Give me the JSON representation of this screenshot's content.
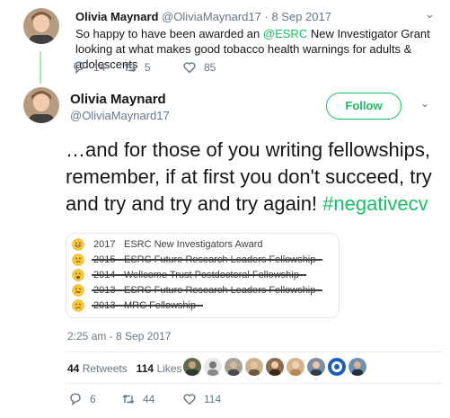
{
  "parent": {
    "name": "Olivia Maynard",
    "handle": "@OliviaMaynard17",
    "separator": "·",
    "date": "8 Sep 2017",
    "text_before": "So happy to have been awarded an ",
    "mention": "@ESRC",
    "text_after": " New Investigator Grant looking at what makes good tobacco health warnings for adults & adolescents",
    "replies": "14",
    "retweets": "5",
    "likes": "85",
    "caret_icon": "chevron-down-icon"
  },
  "tweet": {
    "name": "Olivia Maynard",
    "handle": "@OliviaMaynard17",
    "follow_label": "Follow",
    "text": "…and for those of you writing fellowships, remember, if at first you don't succeed, try and try and try and try again! ",
    "hashtag": "#negativecv",
    "card": {
      "rows": [
        {
          "emoji": "grinning-face",
          "year": "2017",
          "text": "ESRC New Investigators Award",
          "struck": false
        },
        {
          "emoji": "persevering-face",
          "year": "2015",
          "text": "ESRC Future Research Leaders Fellowship",
          "struck": true
        },
        {
          "emoji": "weary-face",
          "year": "2014",
          "text": "Wellcome Trust Postdoctoral Fellowship",
          "struck": true
        },
        {
          "emoji": "confounded-face",
          "year": "2013",
          "text": "ESRC Future Research Leaders Fellowship",
          "struck": true
        },
        {
          "emoji": "frowning-face",
          "year": "2013",
          "text": "MRC Fellowship",
          "struck": true
        }
      ]
    },
    "timestamp": "2:25 am - 8 Sep 2017",
    "retweets_count": "44",
    "retweets_label": "Retweets",
    "likes_count": "114",
    "likes_label": "Likes",
    "replies": "6",
    "retweets": "44",
    "likes": "114"
  },
  "colors": {
    "accent": "#17bf63",
    "text": "#14171a",
    "muted": "#657786",
    "border": "#e1e8ed",
    "thread_line": "#a8e6b4"
  }
}
